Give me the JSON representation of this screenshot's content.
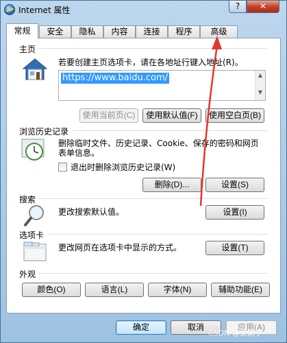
{
  "window": {
    "title": "Internet 属性",
    "help_label": "?",
    "close_label": "✕"
  },
  "tabs": [
    "常规",
    "安全",
    "隐私",
    "内容",
    "连接",
    "程序",
    "高级"
  ],
  "homepage": {
    "title": "主页",
    "desc": "若要创建主页选项卡，请在各地址行键入地址(R)。",
    "url": "https://www.baidu.com/",
    "btn_current": "使用当前页(C)",
    "btn_default": "使用默认值(F)",
    "btn_blank": "使用空白页(B)"
  },
  "history": {
    "title": "浏览历史记录",
    "desc_line1": "删除临时文件、历史记录、Cookie、保存的密码和网页",
    "desc_line2": "表单信息。",
    "checkbox_label": "退出时删除浏览历史记录(W)",
    "btn_delete": "删除(D)...",
    "btn_settings": "设置(S)"
  },
  "search": {
    "title": "搜索",
    "desc": "更改搜索默认值。",
    "btn_settings": "设置(I)"
  },
  "tabs_section": {
    "title": "选项卡",
    "desc": "更改网页在选项卡中显示的方式。",
    "btn_settings": "设置(T)"
  },
  "appearance": {
    "title": "外观",
    "btn_colors": "颜色(O)",
    "btn_languages": "语言(L)",
    "btn_fonts": "字体(N)",
    "btn_accessibility": "辅助功能(E)"
  },
  "footer": {
    "ok": "确定",
    "cancel": "取消",
    "apply": "应用(A)",
    "watermark": "CSDN @梁前亨"
  },
  "colors": {
    "accent": "#3399ff",
    "arrow": "#e8342a"
  }
}
